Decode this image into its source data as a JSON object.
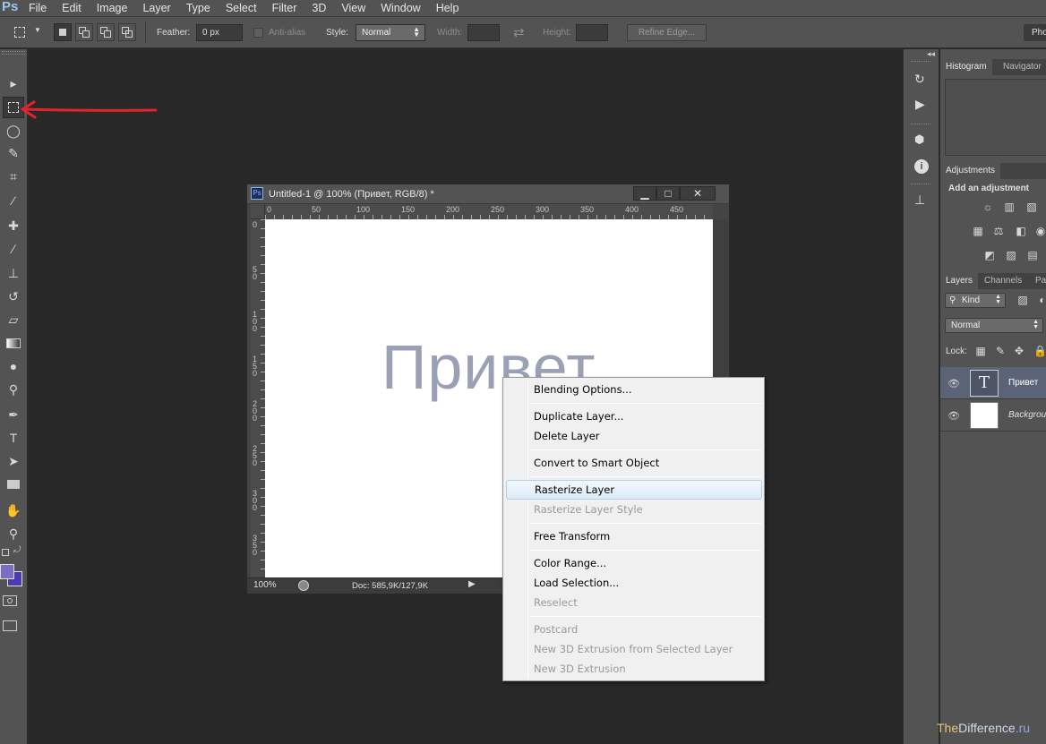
{
  "menubar": {
    "logo": "Ps",
    "items": [
      "File",
      "Edit",
      "Image",
      "Layer",
      "Type",
      "Select",
      "Filter",
      "3D",
      "View",
      "Window",
      "Help"
    ]
  },
  "options": {
    "feather_label": "Feather:",
    "feather_value": "0 px",
    "antialias_label": "Anti-alias",
    "style_label": "Style:",
    "style_value": "Normal",
    "width_label": "Width:",
    "height_label": "Height:",
    "refine_edge": "Refine Edge...",
    "workspace": "Pho"
  },
  "toolbar": {
    "tools": [
      "move-tool",
      "marquee-tool",
      "lasso-tool",
      "quick-selection-tool",
      "crop-tool",
      "eyedropper-tool",
      "healing-brush-tool",
      "brush-tool",
      "clone-stamp-tool",
      "history-brush-tool",
      "eraser-tool",
      "gradient-tool",
      "blur-tool",
      "dodge-tool",
      "pen-tool",
      "type-tool",
      "path-selection-tool",
      "rectangle-tool",
      "hand-tool",
      "zoom-tool"
    ],
    "foreground_color": "#7a6fc4",
    "background_color": "#4a3bb0"
  },
  "document": {
    "title": "Untitled-1 @ 100% (Привет, RGB/8) *",
    "ps_icon": "Ps",
    "canvas_text": "Привет",
    "zoom": "100%",
    "doc_info": "Doc: 585,9K/127,9K",
    "hruler": [
      "0",
      "50",
      "100",
      "150",
      "200",
      "250",
      "300",
      "350",
      "400",
      "450"
    ],
    "vruler": [
      "0",
      "5\n0",
      "1\n0\n0",
      "1\n5\n0",
      "2\n0\n0",
      "2\n5\n0",
      "3\n0\n0",
      "3\n5\n0"
    ]
  },
  "context_menu": {
    "groups": [
      [
        {
          "label": "Blending Options...",
          "enabled": true
        }
      ],
      [
        {
          "label": "Duplicate Layer...",
          "enabled": true
        },
        {
          "label": "Delete Layer",
          "enabled": true
        }
      ],
      [
        {
          "label": "Convert to Smart Object",
          "enabled": true
        }
      ],
      [
        {
          "label": "Rasterize Layer",
          "enabled": true,
          "highlighted": true
        },
        {
          "label": "Rasterize Layer Style",
          "enabled": false
        }
      ],
      [
        {
          "label": "Free Transform",
          "enabled": true
        }
      ],
      [
        {
          "label": "Color Range...",
          "enabled": true
        },
        {
          "label": "Load Selection...",
          "enabled": true
        },
        {
          "label": "Reselect",
          "enabled": false
        }
      ],
      [
        {
          "label": "Postcard",
          "enabled": false
        },
        {
          "label": "New 3D Extrusion from Selected Layer",
          "enabled": false
        },
        {
          "label": "New 3D Extrusion",
          "enabled": false
        }
      ]
    ]
  },
  "panels": {
    "histogram_tab": "Histogram",
    "navigator_tab": "Navigator",
    "adjustments_tab": "Adjustments",
    "add_adjustment": "Add an adjustment",
    "layers_tab": "Layers",
    "channels_tab": "Channels",
    "paths_tab": "Pat",
    "kind_label": "Kind",
    "blend_mode": "Normal",
    "lock_label": "Lock:",
    "layers": [
      {
        "name": "Привет",
        "type_icon": "T",
        "selected": true
      },
      {
        "name": "Backgrou",
        "type_icon": "",
        "selected": false
      }
    ]
  },
  "watermark": {
    "part1": "The",
    "part2": "Difference",
    "part3": ".ru"
  }
}
